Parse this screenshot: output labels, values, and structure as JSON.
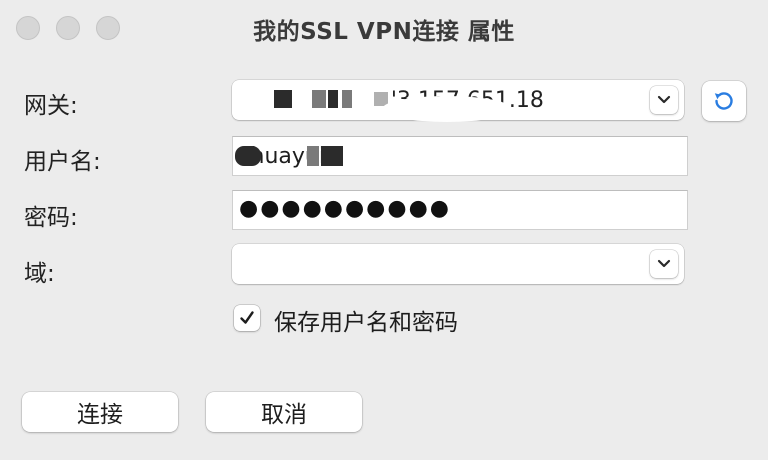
{
  "window": {
    "title": "我的SSL VPN连接 属性"
  },
  "form": {
    "gateway": {
      "label": "网关:",
      "value": "                     '3.157.651.18"
    },
    "username": {
      "label": "用户名:",
      "value": "zhuayui"
    },
    "password": {
      "label": "密码:",
      "value": "●●●●●●●●●●"
    },
    "domain": {
      "label": "域:",
      "value": ""
    },
    "remember": {
      "label": "保存用户名和密码",
      "checked": true
    }
  },
  "buttons": {
    "connect": "连接",
    "cancel": "取消"
  },
  "icons": {
    "refresh": "refresh-icon",
    "dropdown": "chevron-down-icon",
    "check": "checkmark-icon"
  },
  "colors": {
    "refresh_accent": "#2a7de1"
  }
}
